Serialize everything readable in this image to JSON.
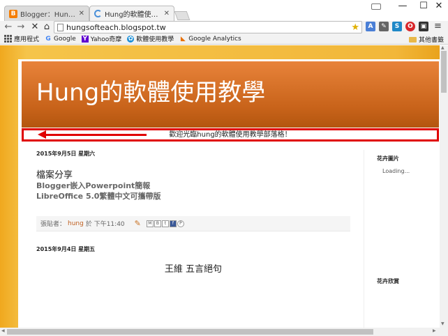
{
  "tabs": [
    {
      "title": "Blogger：Hung的軟體使",
      "icon": "blogger-icon"
    },
    {
      "title": "Hung的軟體使用教學",
      "icon": "loading-spinner-icon"
    }
  ],
  "address_bar": {
    "url": "hungsofteach.blogspot.tw"
  },
  "bookmarks": {
    "items": [
      {
        "label": "應用程式",
        "icon": "apps-icon"
      },
      {
        "label": "Google",
        "icon": "google-icon"
      },
      {
        "label": "Yahoo奇摩",
        "icon": "yahoo-icon"
      },
      {
        "label": "軟體使用教學",
        "icon": "blog-icon"
      },
      {
        "label": "Google Analytics",
        "icon": "analytics-icon"
      }
    ],
    "other": "其他書籤"
  },
  "blog": {
    "title": "Hung的軟體使用教學",
    "description": "歡迎光臨hung的軟體使用教學部落格！",
    "posts": [
      {
        "date": "2015年9月5日 星期六",
        "title": "檔案分享",
        "links": [
          "Blogger嵌入Powerpoint簡報",
          "LibreOffice 5.0繁體中文可攜帶版"
        ],
        "footer_prefix": "張貼者：",
        "author": "hung",
        "footer_time": "於 下午11:40",
        "share_buttons": [
          "M",
          "B",
          "t",
          "f",
          "P"
        ]
      },
      {
        "date": "2015年9月4日 星期五",
        "title": "王維 五言絕句"
      }
    ],
    "sidebar": {
      "widget1_title": "花卉圖片",
      "widget1_status": "Loading...",
      "widget2_title": "花卉欣賞"
    }
  },
  "colors": {
    "header_orange": "#c8631a",
    "annotation_red": "#e00000",
    "page_bg_gold": "#f2b73a"
  }
}
